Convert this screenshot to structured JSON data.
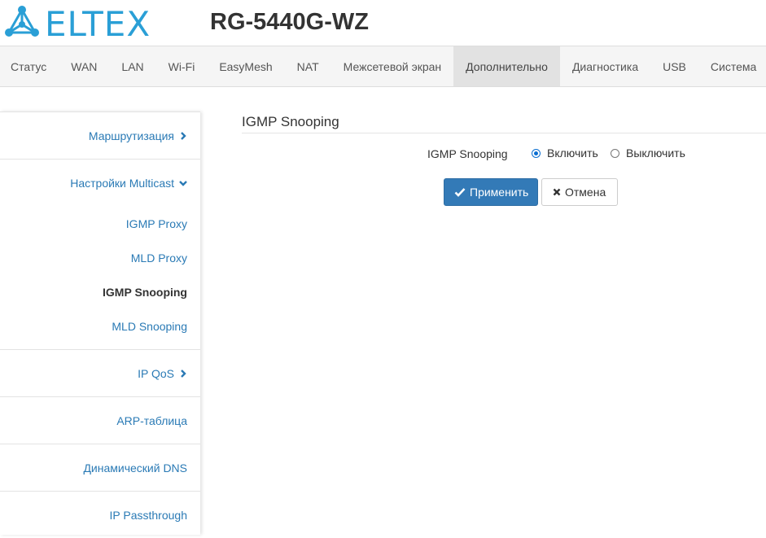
{
  "header": {
    "logo_text": "ELTEX",
    "model": "RG-5440G-WZ"
  },
  "nav": {
    "items": [
      "Статус",
      "WAN",
      "LAN",
      "Wi-Fi",
      "EasyMesh",
      "NAT",
      "Межсетевой экран",
      "Дополнительно",
      "Диагностика",
      "USB",
      "Система"
    ],
    "active": "Дополнительно"
  },
  "sidebar": {
    "routing": "Маршрутизация",
    "multicast": "Настройки Multicast",
    "multicast_items": [
      "IGMP Proxy",
      "MLD Proxy",
      "IGMP Snooping",
      "MLD Snooping"
    ],
    "active_item": "IGMP Snooping",
    "ipqos": "IP QoS",
    "arp": "ARP-таблица",
    "ddns": "Динамический DNS",
    "passthrough": "IP Passthrough"
  },
  "main": {
    "title": "IGMP Snooping",
    "field_label": "IGMP Snooping",
    "option_enable": "Включить",
    "option_disable": "Выключить",
    "selected": "enable",
    "apply_label": "Применить",
    "cancel_label": "Отмена"
  },
  "colors": {
    "brand": "#2a9fd6",
    "link": "#2a7ab5",
    "primary_button": "#337ab7"
  }
}
